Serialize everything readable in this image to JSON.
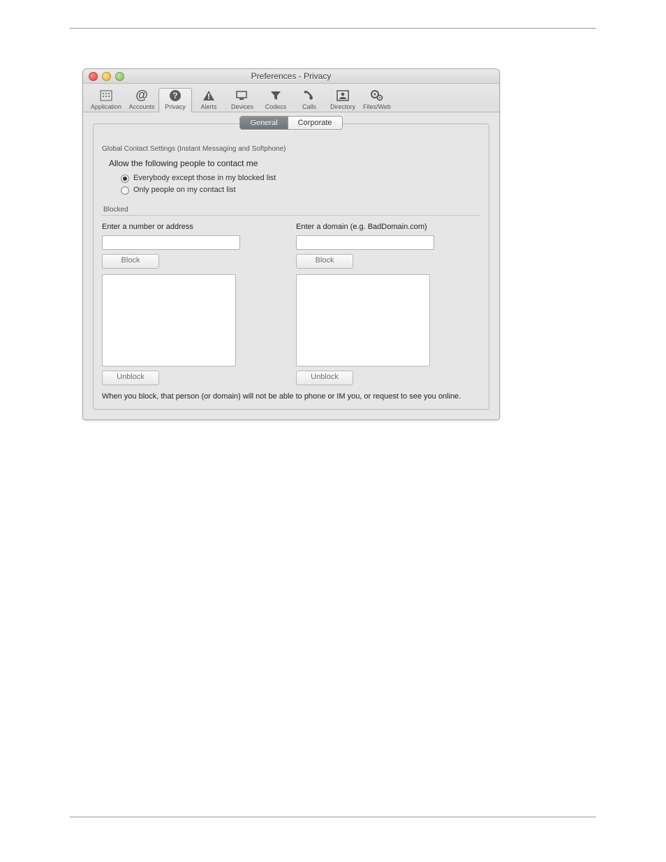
{
  "window": {
    "title": "Preferences - Privacy"
  },
  "toolbar": {
    "items": [
      {
        "label": "Application",
        "selected": false
      },
      {
        "label": "Accounts",
        "selected": false
      },
      {
        "label": "Privacy",
        "selected": true
      },
      {
        "label": "Alerts",
        "selected": false
      },
      {
        "label": "Devices",
        "selected": false
      },
      {
        "label": "Codecs",
        "selected": false
      },
      {
        "label": "Calls",
        "selected": false
      },
      {
        "label": "Directory",
        "selected": false
      },
      {
        "label": "Files/Web",
        "selected": false
      }
    ]
  },
  "tabs": {
    "general": "General",
    "corporate": "Corporate",
    "active": "General"
  },
  "contact_settings": {
    "legend": "Global Contact Settings (Instant Messaging and Softphone)",
    "heading": "Allow the following people to contact me",
    "options": [
      "Everybody except those in my blocked list",
      "Only people on my contact list"
    ],
    "selected_index": 0
  },
  "blocked": {
    "section_label": "Blocked",
    "address": {
      "label": "Enter a number or address",
      "value": "",
      "block_btn": "Block",
      "unblock_btn": "Unblock",
      "list": []
    },
    "domain": {
      "label": "Enter a domain (e.g. BadDomain.com)",
      "value": "",
      "block_btn": "Block",
      "unblock_btn": "Unblock",
      "list": []
    },
    "footnote": "When you block, that person (or domain) will not be able to phone or IM you, or request to see you online."
  }
}
